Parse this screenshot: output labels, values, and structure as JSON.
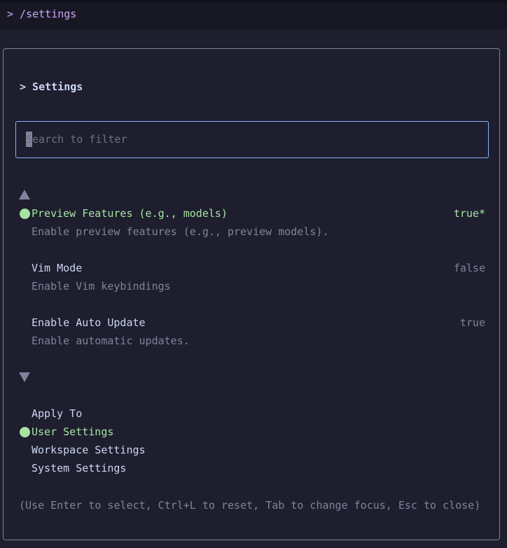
{
  "command": {
    "text": "> /settings"
  },
  "dialog": {
    "title": "> Settings",
    "search": {
      "placeholder": "Search to filter",
      "value": ""
    },
    "settings": [
      {
        "name": "Preview Features (e.g., models)",
        "description": "Enable preview features (e.g., preview models).",
        "value": "true*",
        "selected": true
      },
      {
        "name": "Vim Mode",
        "description": "Enable Vim keybindings",
        "value": "false",
        "selected": false
      },
      {
        "name": "Enable Auto Update",
        "description": "Enable automatic updates.",
        "value": "true",
        "selected": false
      }
    ],
    "apply_to": {
      "label": "Apply To",
      "options": [
        {
          "label": "User Settings",
          "selected": true
        },
        {
          "label": "Workspace Settings",
          "selected": false
        },
        {
          "label": "System Settings",
          "selected": false
        }
      ]
    },
    "help": "(Use Enter to select, Ctrl+L to reset, Tab to change focus, Esc to close)"
  },
  "colors": {
    "accent": "#a6e3a1",
    "border": "#7f849c",
    "focus_border": "#89b4fa",
    "command": "#cba6f7"
  },
  "icons": {
    "scroll_up": "triangle-up-icon",
    "scroll_down": "triangle-down-icon",
    "selection": "green-dot-icon"
  }
}
